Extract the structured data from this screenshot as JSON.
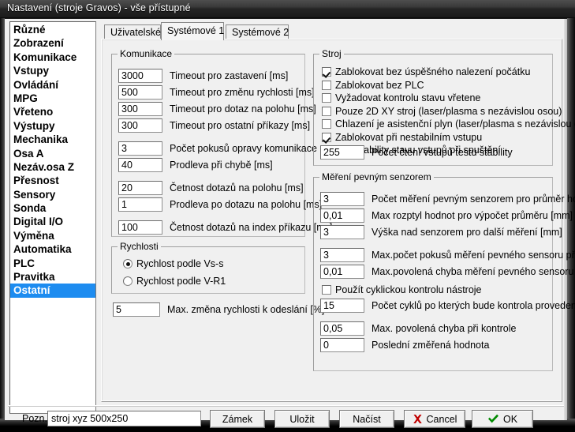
{
  "window": {
    "title": "Nastavení (stroje Gravos) - vše přístupné"
  },
  "sidebar": {
    "items": [
      {
        "label": "Různé",
        "selected": false
      },
      {
        "label": "Zobrazení",
        "selected": false
      },
      {
        "label": "Komunikace",
        "selected": false
      },
      {
        "label": "Vstupy",
        "selected": false
      },
      {
        "label": "Ovládání",
        "selected": false
      },
      {
        "label": "MPG",
        "selected": false
      },
      {
        "label": "Vřeteno",
        "selected": false
      },
      {
        "label": "Výstupy",
        "selected": false
      },
      {
        "label": "Mechanika",
        "selected": false
      },
      {
        "label": "Osa A",
        "selected": false
      },
      {
        "label": "Nezáv.osa Z",
        "selected": false
      },
      {
        "label": "Přesnost",
        "selected": false
      },
      {
        "label": "Sensory",
        "selected": false
      },
      {
        "label": "Sonda",
        "selected": false
      },
      {
        "label": "Digital I/O",
        "selected": false
      },
      {
        "label": "Výměna",
        "selected": false
      },
      {
        "label": "Automatika",
        "selected": false
      },
      {
        "label": "PLC",
        "selected": false
      },
      {
        "label": "Pravitka",
        "selected": false
      },
      {
        "label": "Ostatní",
        "selected": true
      }
    ]
  },
  "tabs": [
    {
      "label": "Uživatelské",
      "active": false
    },
    {
      "label": "Systémové 1",
      "active": true
    },
    {
      "label": "Systémové 2",
      "active": false
    }
  ],
  "groups": {
    "komunikace": {
      "title": "Komunikace",
      "fields": [
        {
          "value": "3000",
          "label": "Timeout pro zastavení  [ms]"
        },
        {
          "value": "500",
          "label": "Timeout pro změnu rychlosti  [ms]"
        },
        {
          "value": "300",
          "label": "Timeout pro dotaz na polohu  [ms]"
        },
        {
          "value": "300",
          "label": "Timeout pro ostatní příkazy  [ms]"
        },
        {
          "value": "3",
          "label": "Počet pokusů opravy komunikace"
        },
        {
          "value": "40",
          "label": "Prodleva při chybě [ms]"
        },
        {
          "value": "20",
          "label": "Četnost dotazů na polohu [ms]"
        },
        {
          "value": "1",
          "label": "Prodleva po dotazu na polohu [ms]"
        },
        {
          "value": "100",
          "label": "Četnost dotazů na index příkazu [ms]"
        }
      ]
    },
    "rychlosti": {
      "title": "Rychlosti",
      "radios": [
        {
          "label": "Rychlost podle Vs-s",
          "checked": true
        },
        {
          "label": "Rychlost podle V-R1",
          "checked": false
        }
      ]
    },
    "max_zmena": {
      "value": "5",
      "label": "Max. změna rychlosti k odeslání [%]"
    },
    "stroj": {
      "title": "Stroj",
      "checkboxes": [
        {
          "label": "Zablokovat bez úspěšného nalezení počátku",
          "checked": true
        },
        {
          "label": "Zablokovat bez PLC",
          "checked": false
        },
        {
          "label": "Vyžadovat kontrolu stavu vřetene",
          "checked": false
        },
        {
          "label": "Pouze 2D XY stroj (laser/plasma s nezávislou osou)",
          "checked": false
        },
        {
          "label": "Chlazení je asistenční plyn  (laser/plasma s nezávislou osou)",
          "checked": false
        },
        {
          "label": "Zablokovat při nestabilním vstupu",
          "checked": true
        },
        {
          "label": "Test stability stavu vstupů při spuštění",
          "checked": true
        }
      ],
      "field": {
        "value": "255",
        "label": "Počet čtení vstupů testu stability"
      }
    },
    "mereni": {
      "title": "Měření pevným senzorem",
      "fields": [
        {
          "value": "3",
          "label": "Počet měření pevným senzorem pro průměr hodnoty"
        },
        {
          "value": "0,01",
          "label": "Max rozptyl hodnot pro výpočet průměru [mm]"
        },
        {
          "value": "3",
          "label": "Výška nad senzorem pro další měření [mm]"
        },
        {
          "value": "3",
          "label": "Max.počet pokusů měření pevného sensoru při chybě"
        },
        {
          "value": "0,01",
          "label": "Max.povolená chyba měření pevného sensoru +-[mm]"
        }
      ],
      "cyclic_checkbox": {
        "label": "Použít cyklickou kontrolu nástroje",
        "checked": false
      },
      "cyclic_fields": [
        {
          "value": "15",
          "label": "Počet cyklů po kterých bude kontrola provedena"
        },
        {
          "value": "0,05",
          "label": "Max. povolená chyba při kontrole"
        },
        {
          "value": "0",
          "label": "Poslední změřená hodnota"
        }
      ]
    }
  },
  "bottom": {
    "pozn_label": "Pozn.",
    "pozn_value": "stroj xyz 500x250",
    "buttons": [
      {
        "label": "Zámek",
        "icon": "none"
      },
      {
        "label": "Uložit",
        "icon": "none"
      },
      {
        "label": "Načíst",
        "icon": "none"
      },
      {
        "label": "Cancel",
        "icon": "red-x-icon"
      },
      {
        "label": "OK",
        "icon": "green-check-icon"
      }
    ]
  },
  "colors": {
    "selection": "#1d8cf0",
    "cancel_icon": "#c00000",
    "ok_icon": "#008a00",
    "window_bg": "#f0f0f0"
  }
}
